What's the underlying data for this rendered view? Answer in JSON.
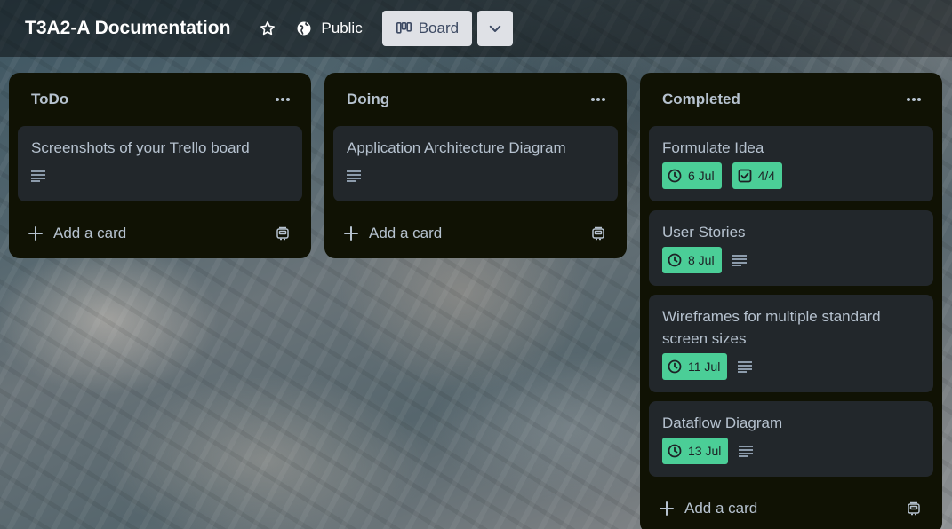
{
  "board": {
    "title": "T3A2-A Documentation",
    "visibility_label": "Public",
    "view_label": "Board"
  },
  "colors": {
    "list_bg": "#101204",
    "card_bg": "#22272b",
    "text": "#b6c2cf",
    "badge_green": "#4bce97",
    "header_button_bg": "#dfe1e6"
  },
  "icons": {
    "star": "star-icon",
    "public": "globe-icon",
    "board": "board-icon",
    "chevron": "chevron-down-icon",
    "menu": "more-horizontal-icon",
    "description": "description-icon",
    "clock": "clock-icon",
    "checklist": "checklist-icon",
    "add": "plus-icon",
    "template": "card-template-icon"
  },
  "lists": [
    {
      "title": "ToDo",
      "add_label": "Add a card",
      "cards": [
        {
          "title": "Screenshots of your Trello board"
        }
      ]
    },
    {
      "title": "Doing",
      "add_label": "Add a card",
      "cards": [
        {
          "title": "Application Architecture Diagram"
        }
      ]
    },
    {
      "title": "Completed",
      "add_label": "Add a card",
      "cards": [
        {
          "title": "Formulate Idea",
          "due": "6 Jul",
          "checklist": "4/4"
        },
        {
          "title": "User Stories",
          "due": "8 Jul"
        },
        {
          "title": "Wireframes for multiple standard screen sizes",
          "due": "11 Jul"
        },
        {
          "title": "Dataflow Diagram",
          "due": "13 Jul"
        }
      ]
    }
  ]
}
